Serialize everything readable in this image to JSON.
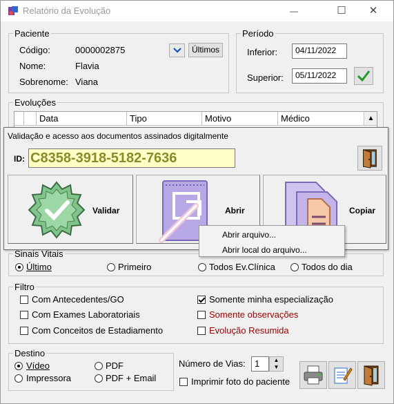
{
  "window": {
    "title": "Relatório da Evolução",
    "controls": {
      "minimize": "—",
      "maximize": "☐",
      "close": "✕"
    }
  },
  "paciente": {
    "legend": "Paciente",
    "codigo_label": "Código:",
    "codigo_value": "0000002875",
    "nome_label": "Nome:",
    "nome_value": "Flavia",
    "sobrenome_label": "Sobrenome:",
    "sobrenome_value": "Viana",
    "ultimos_label": "Últimos"
  },
  "periodo": {
    "legend": "Período",
    "inferior_label": "Inferior:",
    "inferior_value": "04/11/2022",
    "superior_label": "Superior:",
    "superior_value": "05/11/2022"
  },
  "evolucoes": {
    "legend": "Evoluções",
    "columns": [
      "Data",
      "Tipo",
      "Motivo",
      "Médico"
    ]
  },
  "validacao": {
    "header": "Validação e acesso aos documentos assinados digitalmente",
    "id_label": "ID:",
    "id_value": "C8358-3918-5182-7636",
    "validar_label": "Validar",
    "abrir_label": "Abrir",
    "copiar_label": "Copiar"
  },
  "context_menu": {
    "items": [
      "Abrir arquivo...",
      "Abrir local do arquivo..."
    ]
  },
  "sinais_vitais": {
    "legend": "Sinais Vitais",
    "options": [
      {
        "label": "Último",
        "selected": true
      },
      {
        "label": "Primeiro",
        "selected": false
      },
      {
        "label": "Todos Ev.Clínica",
        "selected": false
      },
      {
        "label": "Todos do dia",
        "selected": false
      }
    ]
  },
  "filtro": {
    "legend": "Filtro",
    "left": [
      {
        "label": "Com Antecedentes/GO",
        "checked": false
      },
      {
        "label": "Com Exames Laboratoriais",
        "checked": false
      },
      {
        "label": "Com Conceitos de Estadiamento",
        "checked": false
      }
    ],
    "right": [
      {
        "label": "Somente minha especialização",
        "checked": true
      },
      {
        "label": "Somente observações",
        "checked": false
      },
      {
        "label": "Evolução Resumida",
        "checked": false
      }
    ],
    "highlight_color": "#990000"
  },
  "destino": {
    "legend": "Destino",
    "options": [
      {
        "label": "Vídeo",
        "selected": true
      },
      {
        "label": "PDF",
        "selected": false
      },
      {
        "label": "Impressora",
        "selected": false
      },
      {
        "label": "PDF + Email",
        "selected": false
      }
    ]
  },
  "vias": {
    "label": "Número de Vias:",
    "value": "1",
    "imprimir_foto_label": "Imprimir foto do paciente",
    "imprimir_foto_checked": false
  },
  "icons": {
    "app": "app-icon",
    "dropdown": "chevron-down-icon",
    "confirm": "green-check-icon",
    "exit": "exit-door-icon",
    "validate": "badge-check-icon",
    "open": "open-file-arrow-icon",
    "copy": "copy-documents-icon",
    "print": "printer-icon",
    "edit": "edit-notes-icon"
  }
}
